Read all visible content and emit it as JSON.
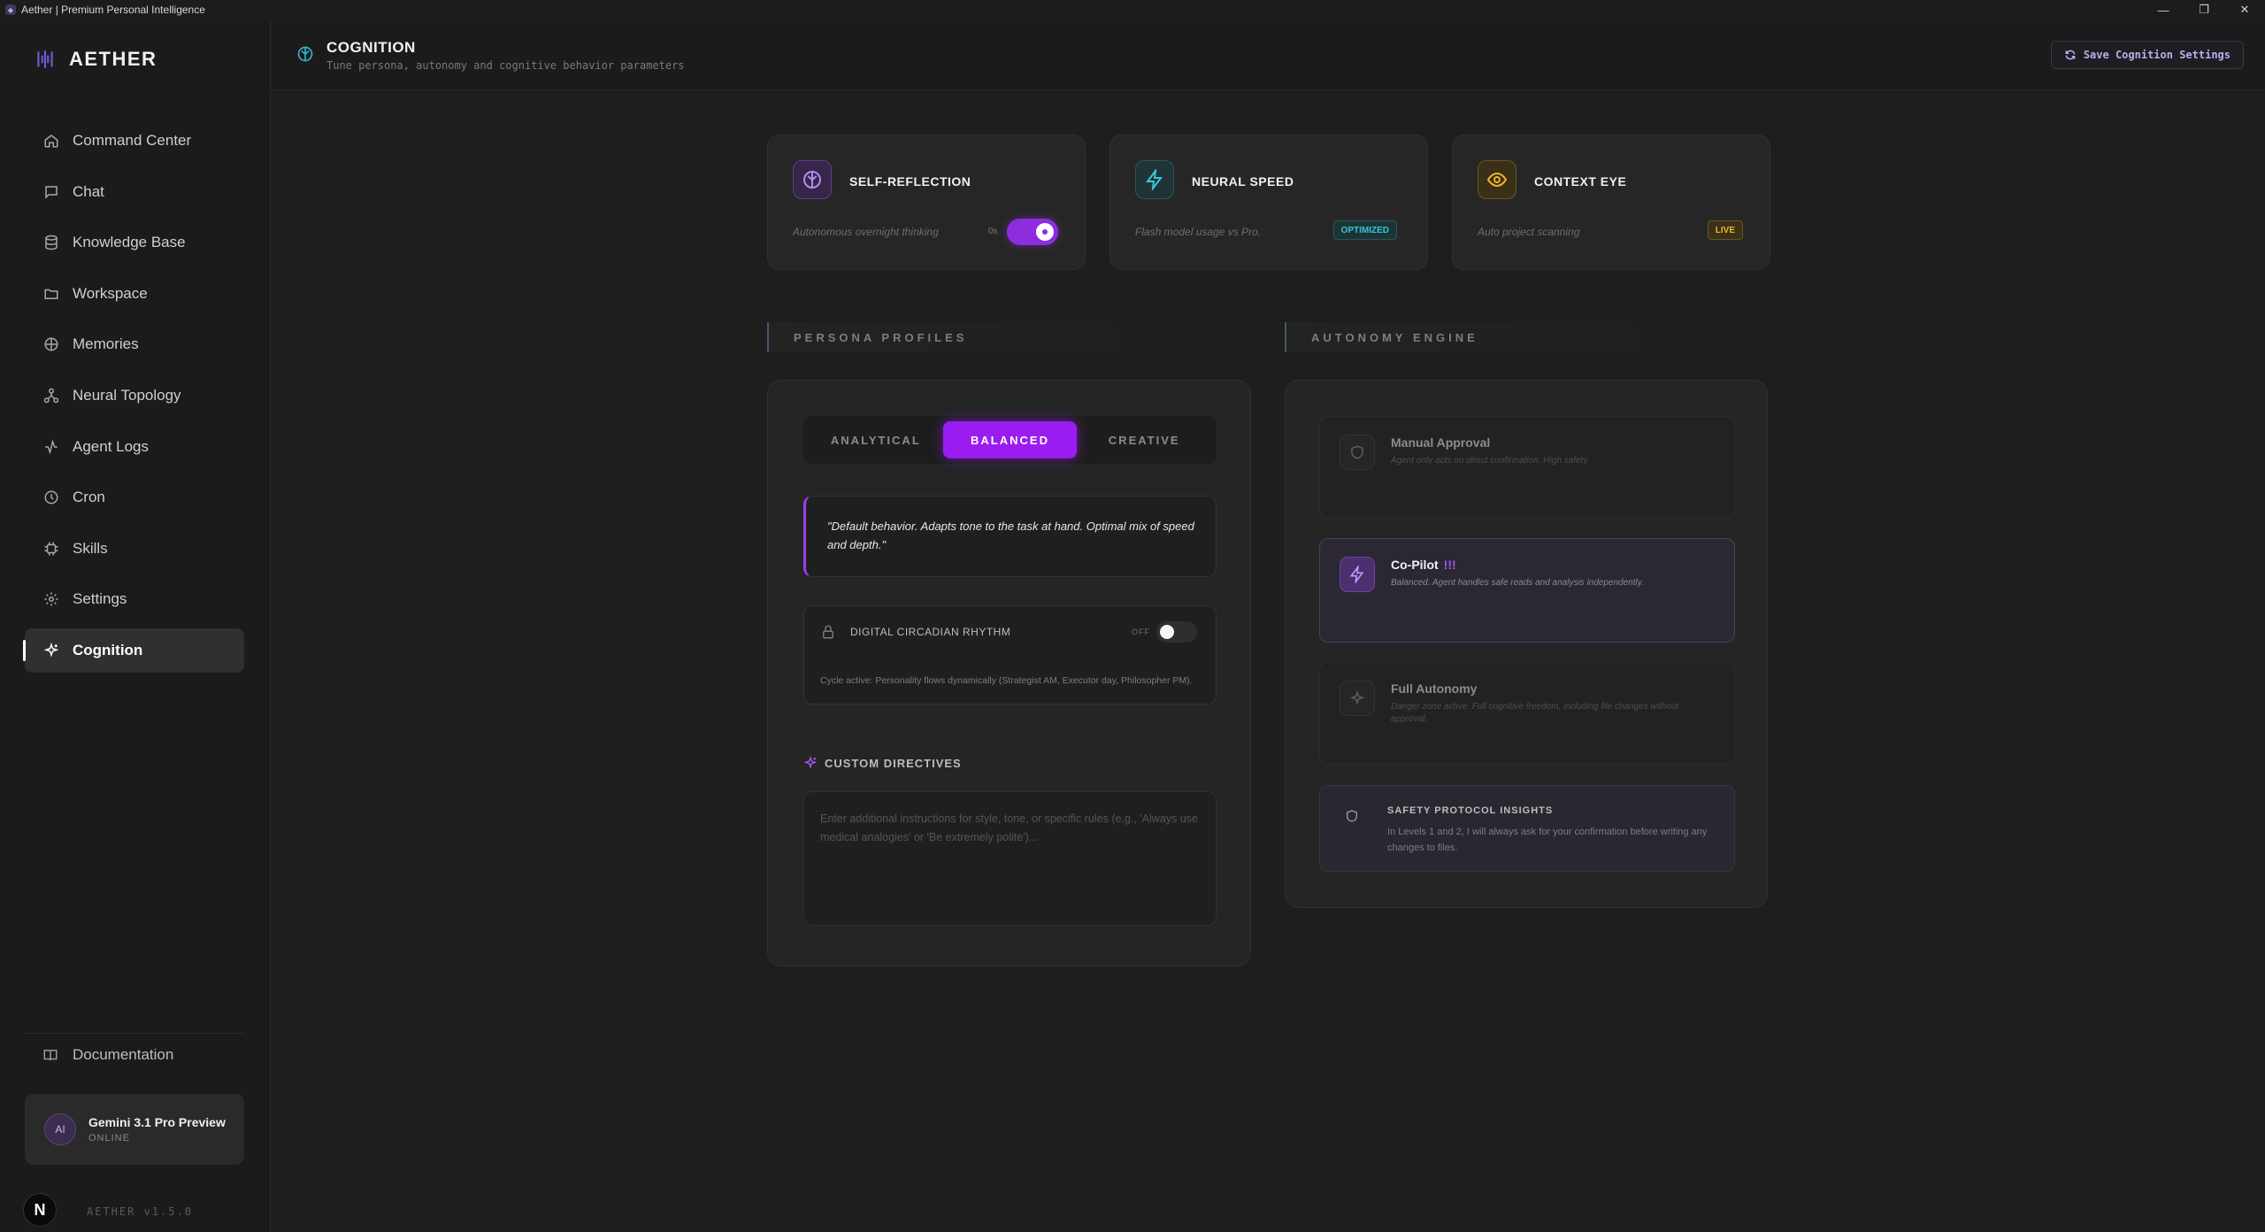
{
  "window": {
    "title": "Aether | Premium Personal Intelligence",
    "controls": [
      "minimize",
      "restore",
      "close"
    ]
  },
  "brand": {
    "name": "AETHER"
  },
  "sidebar": {
    "items": [
      {
        "label": "Command Center",
        "icon": "home-icon"
      },
      {
        "label": "Chat",
        "icon": "chat-icon"
      },
      {
        "label": "Knowledge Base",
        "icon": "database-icon"
      },
      {
        "label": "Workspace",
        "icon": "folder-icon"
      },
      {
        "label": "Memories",
        "icon": "brain-icon"
      },
      {
        "label": "Neural Topology",
        "icon": "network-icon"
      },
      {
        "label": "Agent Logs",
        "icon": "activity-icon"
      },
      {
        "label": "Cron",
        "icon": "clock-icon"
      },
      {
        "label": "Skills",
        "icon": "cpu-icon"
      },
      {
        "label": "Settings",
        "icon": "gear-icon"
      },
      {
        "label": "Cognition",
        "icon": "sparkles-icon",
        "active": true
      }
    ],
    "documentation": "Documentation",
    "model": {
      "avatar": "AI",
      "name": "Gemini 3.1 Pro Preview",
      "status": "ONLINE"
    },
    "n_badge": "N",
    "version": "AETHER v1.5.0"
  },
  "header": {
    "title": "COGNITION",
    "subtitle": "Tune persona, autonomy and cognitive behavior parameters",
    "save_button": "Save Cognition Settings"
  },
  "metrics": {
    "self_reflection": {
      "title": "SELF-REFLECTION",
      "desc": "Autonomous overnight thinking",
      "toggle_label": "0s",
      "enabled": true
    },
    "neural_speed": {
      "title": "NEURAL SPEED",
      "desc": "Flash model usage vs Pro.",
      "tag": "OPTIMIZED"
    },
    "context_eye": {
      "title": "CONTEXT EYE",
      "desc": "Auto project scanning",
      "tag": "LIVE"
    }
  },
  "persona": {
    "section_title": "PERSONA PROFILES",
    "tabs": [
      "ANALYTICAL",
      "BALANCED",
      "CREATIVE"
    ],
    "active_tab": "BALANCED",
    "quote": "\"Default behavior. Adapts tone to the task at hand. Optimal mix of speed and depth.\"",
    "rhythm": {
      "title": "DIGITAL CIRCADIAN RHYTHM",
      "toggle_label": "OFF",
      "enabled": false,
      "desc": "Cycle active: Personality flows dynamically (Strategist AM, Executor day, Philosopher PM)."
    },
    "custom_directives": {
      "title": "CUSTOM DIRECTIVES",
      "value": "",
      "placeholder": "Enter additional instructions for style, tone, or specific rules (e.g., 'Always use medical analogies' or 'Be extremely polite')..."
    }
  },
  "autonomy": {
    "section_title": "AUTONOMY ENGINE",
    "options": [
      {
        "title": "Manual Approval",
        "desc": "Agent only acts on direct confirmation. High safety.",
        "icon": "shield-icon"
      },
      {
        "title": "Co-Pilot",
        "badge": "!!!",
        "desc": "Balanced. Agent handles safe reads and analysis independently.",
        "icon": "zap-icon",
        "selected": true
      },
      {
        "title": "Full Autonomy",
        "desc": "Danger zone active. Full cognitive freedom, including file changes without approval.",
        "icon": "sparkles-icon"
      }
    ],
    "safety": {
      "title": "SAFETY PROTOCOL INSIGHTS",
      "desc": "In Levels 1 and 2, I will always ask for your confirmation before writing any changes to files."
    }
  },
  "colors": {
    "accent_purple": "#9b1cf0",
    "accent_teal": "#2fb7c9",
    "accent_amber": "#f0b429",
    "background": "#1e1e1e",
    "sidebar": "#1b1b1b"
  }
}
